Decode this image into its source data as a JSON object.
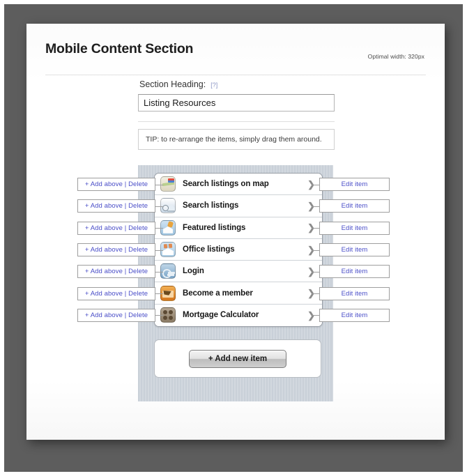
{
  "header": {
    "title": "Mobile Content Section",
    "optimal_width": "Optimal width: 320px"
  },
  "heading_form": {
    "label": "Section Heading:",
    "help_link": "[?]",
    "value": "Listing Resources",
    "placeholder": "Section Heading"
  },
  "tip": {
    "text": "TIP: to re-arrange the items, simply drag them around."
  },
  "buttons": {
    "left_label": "+ Add above | Delete",
    "right_label": "Edit item",
    "add_new_label": "+ Add new item"
  },
  "items": [
    {
      "label": "Search listings on map",
      "icon": "map-icon",
      "chevron": "❯"
    },
    {
      "label": "Search listings",
      "icon": "search-icon",
      "chevron": "❯"
    },
    {
      "label": "Featured listings",
      "icon": "star-house-icon",
      "chevron": "❯"
    },
    {
      "label": "Office listings",
      "icon": "office-icon",
      "chevron": "❯"
    },
    {
      "label": "Login",
      "icon": "key-icon",
      "chevron": "❯"
    },
    {
      "label": "Become a member",
      "icon": "envelope-icon",
      "chevron": "❯"
    },
    {
      "label": "Mortgage Calculator",
      "icon": "calculator-icon",
      "chevron": "❯"
    }
  ],
  "colors": {
    "frame": "#5d5d5d",
    "card": "#fdfdfd",
    "link": "#4a4ec8",
    "stripe": "#c9d0d8"
  }
}
